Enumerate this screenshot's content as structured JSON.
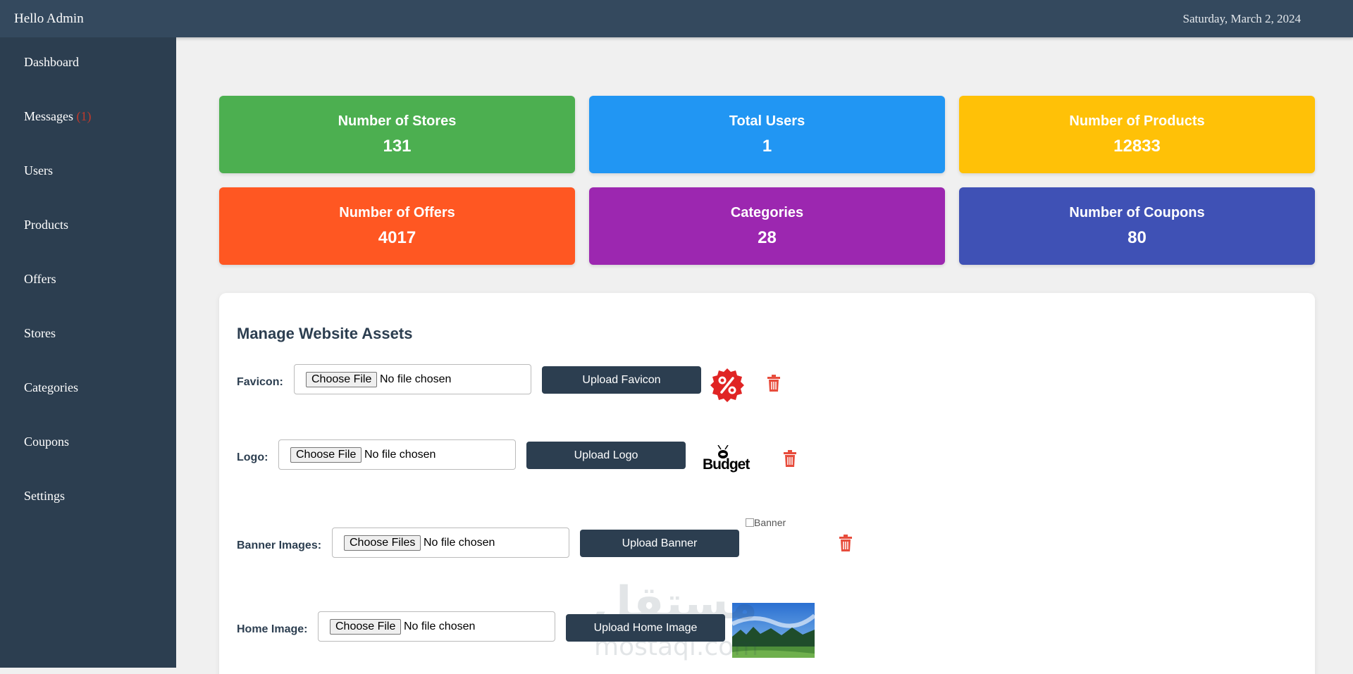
{
  "header": {
    "greeting": "Hello Admin",
    "date": "Saturday, March 2, 2024"
  },
  "sidebar": {
    "items": [
      {
        "label": "Dashboard"
      },
      {
        "label": "Messages",
        "badge": "(1)"
      },
      {
        "label": "Users"
      },
      {
        "label": "Products"
      },
      {
        "label": "Offers"
      },
      {
        "label": "Stores"
      },
      {
        "label": "Categories"
      },
      {
        "label": "Coupons"
      },
      {
        "label": "Settings"
      }
    ]
  },
  "stats": [
    {
      "title": "Number of Stores",
      "value": "131",
      "color": "#4caf50"
    },
    {
      "title": "Total Users",
      "value": "1",
      "color": "#2196f3"
    },
    {
      "title": "Number of Products",
      "value": "12833",
      "color": "#ffc107"
    },
    {
      "title": "Number of Offers",
      "value": "4017",
      "color": "#ff5722"
    },
    {
      "title": "Categories",
      "value": "28",
      "color": "#9c27b0"
    },
    {
      "title": "Number of Coupons",
      "value": "80",
      "color": "#3f51b5"
    }
  ],
  "assets": {
    "title": "Manage Website Assets",
    "rows": [
      {
        "label": "Favicon:",
        "choose": "Choose File",
        "status": "No file chosen",
        "upload": "Upload Favicon"
      },
      {
        "label": "Logo:",
        "choose": "Choose File",
        "status": "No file chosen",
        "upload": "Upload Logo",
        "logo_text": "Budget"
      },
      {
        "label": "Banner Images:",
        "choose": "Choose Files",
        "status": "No file chosen",
        "upload": "Upload Banner",
        "image_alt": "Banner"
      },
      {
        "label": "Home Image:",
        "choose": "Choose File",
        "status": "No file chosen",
        "upload": "Upload Home Image"
      }
    ]
  },
  "watermark": {
    "main": "مستقل",
    "sub": "mostaqi.com"
  },
  "colors": {
    "topbar": "#34495e",
    "sidebar": "#2c3e50",
    "button": "#2c3e50",
    "trash": "#e74c3c",
    "badge": "#c0392b"
  }
}
